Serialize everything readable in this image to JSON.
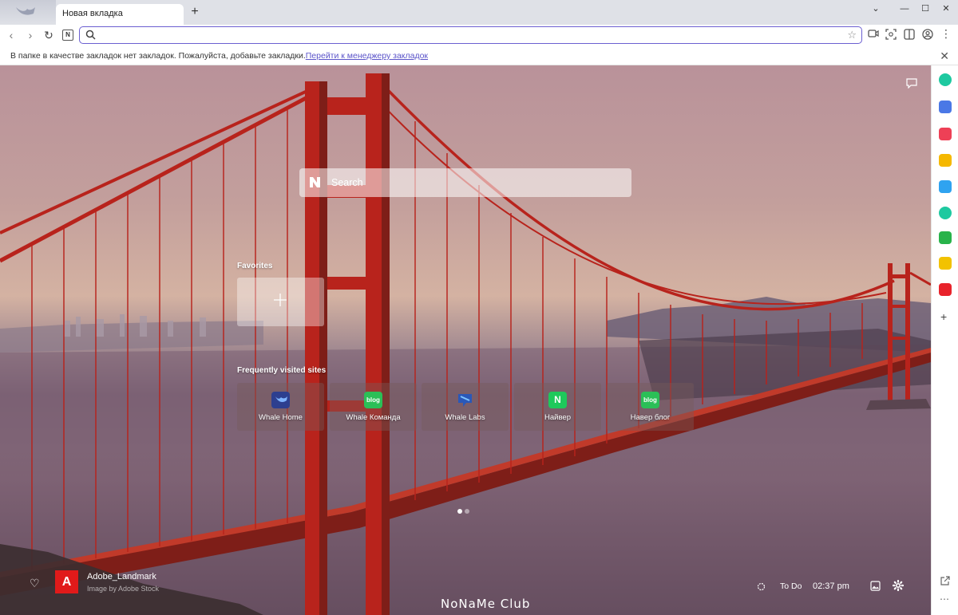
{
  "tabstrip": {
    "tab_title": "Новая вкладка",
    "new_tab_symbol": "+",
    "chevron_symbol": "⌄",
    "minimize_symbol": "—",
    "maximize_symbol": "☐",
    "close_symbol": "✕"
  },
  "toolbar": {
    "back_symbol": "‹",
    "forward_symbol": "›",
    "reload_symbol": "↻",
    "naver_badge": "N",
    "address_value": ""
  },
  "bookmarks_bar": {
    "message": "В папке в качестве закладок нет закладок. Пожалуйста, добавьте закладки.",
    "link_text": "Перейти к менеджеру закладок",
    "close_symbol": "✕"
  },
  "newtab": {
    "search_placeholder": "Search",
    "favorites_label": "Favorites",
    "frequent_label": "Frequently visited sites",
    "sites": [
      {
        "label": "Whale Home",
        "icon": "whale-icon",
        "icon_text": "",
        "color": "#2d3f8f"
      },
      {
        "label": "Whale Команда",
        "icon": "blog-icon",
        "icon_text": "blog",
        "color": "#2bbf57"
      },
      {
        "label": "Whale Labs",
        "icon": "labs-icon",
        "icon_text": "",
        "color": "#2a58b8"
      },
      {
        "label": "Найвер",
        "icon": "naver-icon",
        "icon_text": "N",
        "color": "#1ec95b"
      },
      {
        "label": "Навер блог",
        "icon": "blog-icon",
        "icon_text": "blog",
        "color": "#2bbf57"
      }
    ],
    "page_dots": 2,
    "active_dot": 0
  },
  "footer": {
    "like_symbol": "♡",
    "photo_title": "Adobe_Landmark",
    "photo_credit": "Image by Adobe Stock",
    "watermark": "NoNaMe Club",
    "todo_label": "To Do",
    "time": "02:37 pm"
  },
  "colors": {
    "accent": "#6b5fd1",
    "link": "#5a53c9",
    "adobe_red": "#e11a1a",
    "bridge_red": "#b8231c"
  },
  "sidepanel": {
    "icons": [
      {
        "name": "sidebar-app-green-circle-icon",
        "color": "#1ec9a0"
      },
      {
        "name": "sidebar-app-calendar-icon",
        "color": "#4a78e6"
      },
      {
        "name": "sidebar-app-pocket-icon",
        "color": "#ee4056"
      },
      {
        "name": "sidebar-app-star-icon",
        "color": "#f5b800"
      },
      {
        "name": "sidebar-app-translate-icon",
        "color": "#2fa3f0"
      },
      {
        "name": "sidebar-app-play-icon",
        "color": "#1ec9a0"
      },
      {
        "name": "sidebar-app-whale-space-icon",
        "color": "#28b34a"
      },
      {
        "name": "sidebar-app-memo-icon",
        "color": "#f2c200"
      },
      {
        "name": "sidebar-app-now-icon",
        "color": "#e8232b"
      }
    ],
    "add_symbol": "+",
    "menu_symbol": "⋯"
  }
}
